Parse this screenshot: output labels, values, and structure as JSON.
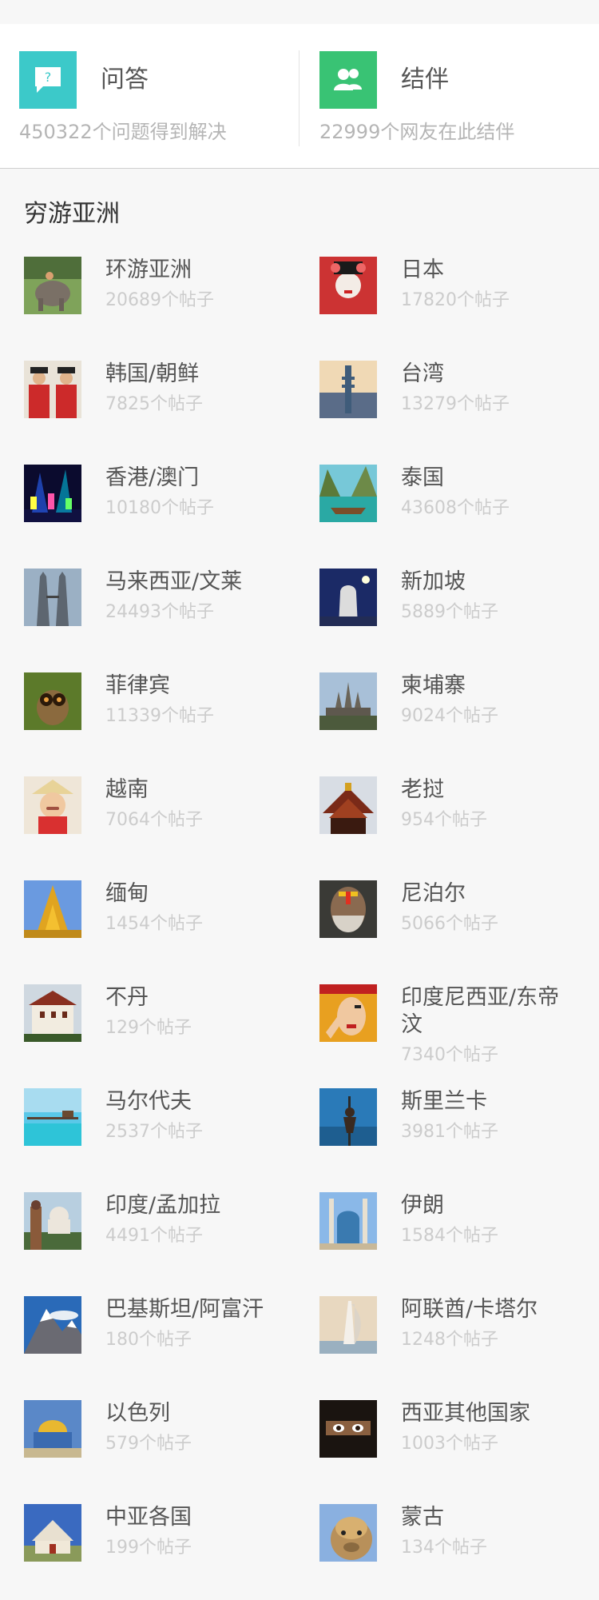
{
  "colors": {
    "qa_icon_bg": "#3cc9c9",
    "partner_icon_bg": "#39c374",
    "title_text": "#555555",
    "count_text": "#cccccc"
  },
  "header": {
    "qa": {
      "icon": "question-bubble-icon",
      "title": "问答",
      "subtitle": "450322个问题得到解决"
    },
    "partner": {
      "icon": "people-icon",
      "title": "结伴",
      "subtitle": "22999个网友在此结伴"
    }
  },
  "section": {
    "title": "穷游亚洲"
  },
  "destinations": [
    {
      "name": "环游亚洲",
      "count": "20689个帖子",
      "thumb": "elephant-photo"
    },
    {
      "name": "日本",
      "count": "17820个帖子",
      "thumb": "geisha-photo"
    },
    {
      "name": "韩国/朝鲜",
      "count": "7825个帖子",
      "thumb": "korean-guards-photo"
    },
    {
      "name": "台湾",
      "count": "13279个帖子",
      "thumb": "taipei-101-photo"
    },
    {
      "name": "香港/澳门",
      "count": "10180个帖子",
      "thumb": "hong-kong-night-photo"
    },
    {
      "name": "泰国",
      "count": "43608个帖子",
      "thumb": "thai-longboat-photo"
    },
    {
      "name": "马来西亚/文莱",
      "count": "24493个帖子",
      "thumb": "petronas-towers-photo"
    },
    {
      "name": "新加坡",
      "count": "5889个帖子",
      "thumb": "merlion-photo"
    },
    {
      "name": "菲律宾",
      "count": "11339个帖子",
      "thumb": "tarsier-photo"
    },
    {
      "name": "柬埔寨",
      "count": "9024个帖子",
      "thumb": "angkor-wat-photo"
    },
    {
      "name": "越南",
      "count": "7064个帖子",
      "thumb": "vietnamese-child-photo"
    },
    {
      "name": "老挝",
      "count": "954个帖子",
      "thumb": "lao-temple-photo"
    },
    {
      "name": "缅甸",
      "count": "1454个帖子",
      "thumb": "golden-pagoda-photo"
    },
    {
      "name": "尼泊尔",
      "count": "5066个帖子",
      "thumb": "sadhu-photo"
    },
    {
      "name": "不丹",
      "count": "129个帖子",
      "thumb": "bhutan-dzong-photo"
    },
    {
      "name": "印度尼西亚/东帝汶",
      "count": "7340个帖子",
      "thumb": "balinese-dancer-photo"
    },
    {
      "name": "马尔代夫",
      "count": "2537个帖子",
      "thumb": "maldives-jetty-photo"
    },
    {
      "name": "斯里兰卡",
      "count": "3981个帖子",
      "thumb": "stilt-fisherman-photo"
    },
    {
      "name": "印度/孟加拉",
      "count": "4491个帖子",
      "thumb": "taj-mahal-photo"
    },
    {
      "name": "伊朗",
      "count": "1584个帖子",
      "thumb": "iran-mosque-photo"
    },
    {
      "name": "巴基斯坦/阿富汗",
      "count": "180个帖子",
      "thumb": "snow-mountain-photo"
    },
    {
      "name": "阿联酋/卡塔尔",
      "count": "1248个帖子",
      "thumb": "burj-al-arab-photo"
    },
    {
      "name": "以色列",
      "count": "579个帖子",
      "thumb": "dome-of-rock-photo"
    },
    {
      "name": "西亚其他国家",
      "count": "1003个帖子",
      "thumb": "veiled-woman-photo"
    },
    {
      "name": "中亚各国",
      "count": "199个帖子",
      "thumb": "yurt-photo"
    },
    {
      "name": "蒙古",
      "count": "134个帖子",
      "thumb": "camel-photo"
    }
  ]
}
